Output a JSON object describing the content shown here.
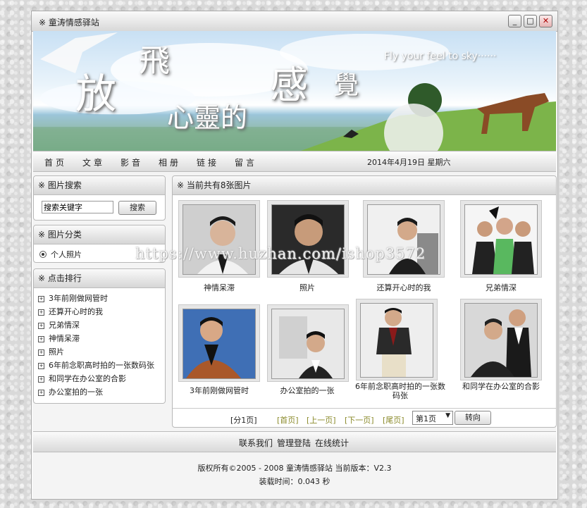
{
  "window": {
    "title": "※ 童涛情感驿站"
  },
  "banner": {
    "chars": [
      "放",
      "飛",
      "心靈的",
      "感",
      "覺"
    ],
    "subtitle": "Fly your feel to sky······"
  },
  "nav": {
    "items": [
      "首页",
      "文章",
      "影音",
      "相册",
      "链接",
      "留言"
    ],
    "date": "2014年4月19日 星期六"
  },
  "search": {
    "title": "※ 图片搜索",
    "placeholder": "搜索关键字",
    "button": "搜索"
  },
  "category": {
    "title": "※ 图片分类",
    "items": [
      "个人照片"
    ]
  },
  "ranking": {
    "title": "※ 点击排行",
    "items": [
      "3年前刚做网管时",
      "还算开心时的我",
      "兄弟情深",
      "神情呆滞",
      "照片",
      "6年前念职高时拍的一张数码张",
      "和同学在办公室的合影",
      "办公室拍的一张"
    ]
  },
  "gallery": {
    "title": "※ 当前共有8张图片",
    "photos": [
      {
        "caption": "神情呆滞",
        "bg": "#cfcfcf"
      },
      {
        "caption": "照片",
        "bg": "#2a2a2a"
      },
      {
        "caption": "还算开心时的我",
        "bg": "#f0f0f0"
      },
      {
        "caption": "兄弟情深",
        "bg": "#f5f5f5"
      },
      {
        "caption": "3年前刚做网管时",
        "bg": "#3f6fb5"
      },
      {
        "caption": "办公室拍的一张",
        "bg": "#e8e8e8"
      },
      {
        "caption": "6年前念职高时拍的一张数码张",
        "bg": "#eeeeee"
      },
      {
        "caption": "和同学在办公室的合影",
        "bg": "#d8d8d8"
      }
    ]
  },
  "pager": {
    "pages": "[分1页]",
    "first": "[首页]",
    "prev": "[上一页]",
    "next": "[下一页]",
    "last": "[尾页]",
    "select": "第1页",
    "go": "转向"
  },
  "footer": {
    "links": [
      "联系我们",
      "管理登陆",
      "在线统计"
    ],
    "copyright": "版权所有©2005 - 2008 童涛情感驿站 当前版本：V2.3",
    "loadtime": "装载时间：0.043 秒"
  },
  "watermark": "https://www.huzhan.com/ishop3572",
  "colors": {
    "pager_link": "#8a8a2a",
    "accent": "#333333"
  }
}
